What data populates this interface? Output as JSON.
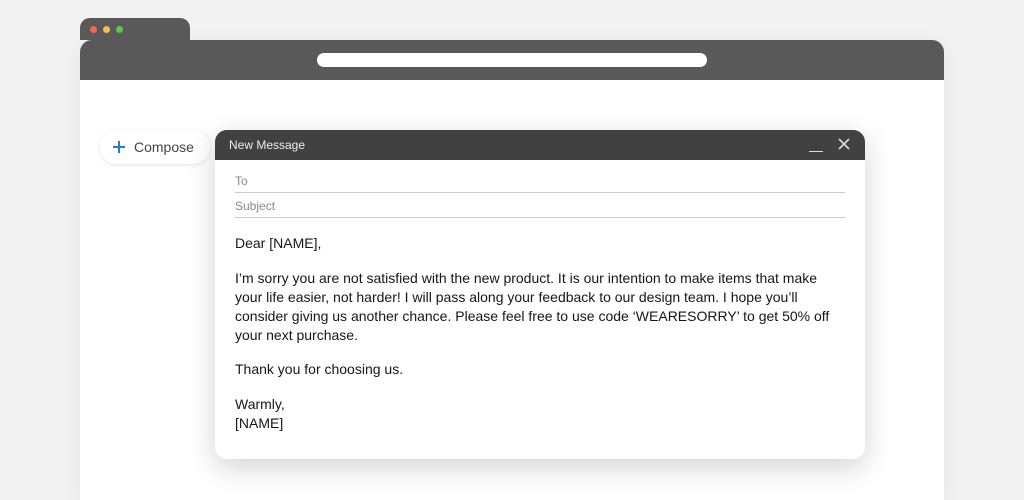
{
  "compose": {
    "label": "Compose"
  },
  "message": {
    "header_title": "New Message",
    "to_label": "To",
    "subject_label": "Subject",
    "body": {
      "greeting": "Dear [NAME],",
      "para1": "I’m sorry you are not satisfied with the new product. It is our intention to make items that make your life easier, not harder! I will pass along your feedback to our design team. I hope you’ll consider giving us another chance. Please feel free to use code ‘WEARESORRY’ to get 50% off your next purchase.",
      "para2": "Thank you for choosing us.",
      "signoff": "Warmly,",
      "signature": "[NAME]"
    }
  }
}
